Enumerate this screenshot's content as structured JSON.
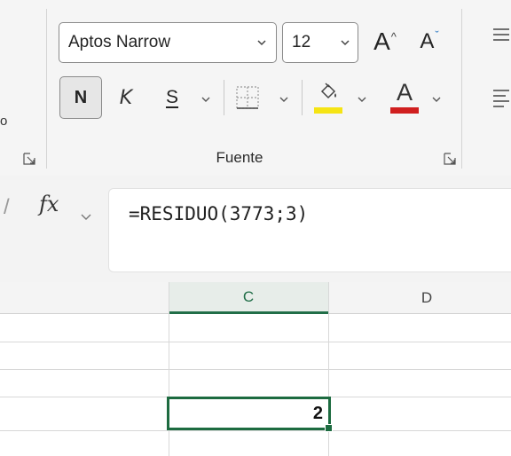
{
  "ribbon": {
    "font_name": "Aptos Narrow",
    "font_size": "12",
    "group_label": "Fuente",
    "left_clip_label": "o",
    "bold_label": "N",
    "italic_label": "K",
    "strike_label": "S",
    "font_color_label": "A",
    "colors": {
      "highlight": "#f5e414",
      "font_color": "#d01f1f"
    },
    "icons": [
      "grow-font-icon",
      "shrink-font-icon",
      "borders-icon",
      "fill-color-icon",
      "font-color-icon",
      "dialog-launcher-icon",
      "align-icon"
    ]
  },
  "formula_bar": {
    "fx_label": "fx",
    "formula": "=RESIDUO(3773;3)"
  },
  "grid": {
    "columns": [
      "C",
      "D"
    ],
    "active_cell_value": "2",
    "accent": "#1d6b40"
  }
}
